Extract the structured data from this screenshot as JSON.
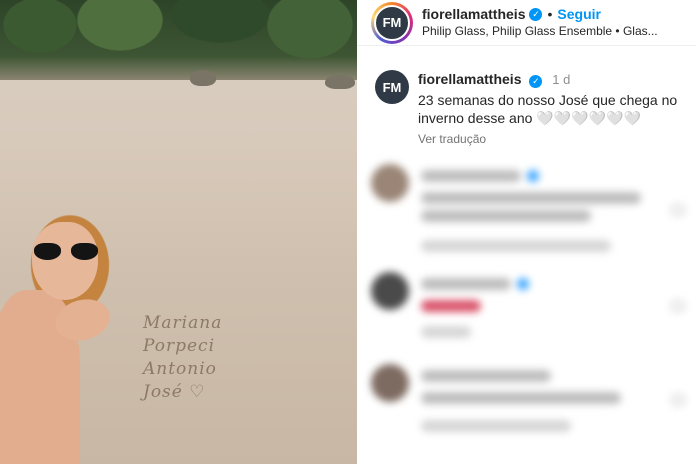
{
  "post": {
    "author": {
      "username": "fiorellamattheis",
      "avatar_initials": "FM",
      "verified_icon": "✓"
    },
    "follow_label": "Seguir",
    "separator": "•",
    "music": "Philip Glass, Philip Glass Ensemble • Glas...",
    "caption": {
      "username": "fiorellamattheis",
      "time": "1 d",
      "text": "23 semanas do nosso José que chega no inverno desse ano 🤍🤍🤍🤍🤍🤍",
      "translate_label": "Ver tradução"
    }
  },
  "photo": {
    "sand_writing": [
      "Mariana",
      "Porpeci",
      "Antonio",
      "José ♡"
    ]
  },
  "colors": {
    "accent": "#0095f6",
    "text": "#262626",
    "muted": "#737373"
  },
  "icons": [
    "verified-badge-icon",
    "heart-icon"
  ]
}
